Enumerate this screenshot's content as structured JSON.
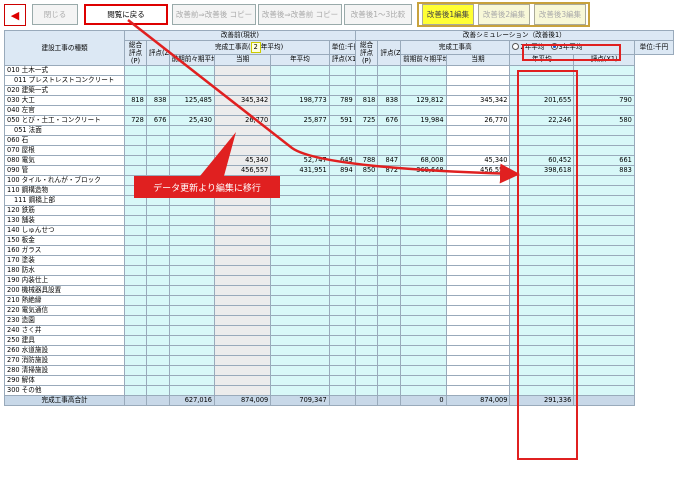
{
  "toolbar": {
    "back_icon": "left-arrow-icon",
    "close": "閉じる",
    "return_view": "閲覧に戻る",
    "copy_before": "改善前⇒改善後 コピー",
    "copy_after": "改善後⇒改善前 コピー",
    "compare": "改善後1〜3比較",
    "edit1": "改善後1編集",
    "edit2": "改善後2編集",
    "edit3": "改善後3編集"
  },
  "header": {
    "category": "建設工事の種類",
    "before_title": "改善前(現状)",
    "after_title": "改善シミュレーション（改善後1）",
    "total_score": "総合評点(P)",
    "score_z": "評点(Z)",
    "completed_before": "完成工事高(",
    "avg_num": "2",
    "completed_before_end": "年平均)",
    "completed_after": "完成工事高",
    "unit": "単位:千円",
    "prev_period": "前期前々期平均",
    "current": "当期",
    "annual_avg": "年平均",
    "score_x1": "評点(X1)",
    "radio2": "2年平均",
    "radio3": "3年平均"
  },
  "rows": [
    {
      "label": "010 土木一式"
    },
    {
      "label": "011 プレストレストコンクリート",
      "sub": true
    },
    {
      "label": "020 建築一式"
    },
    {
      "label": "030 大工",
      "b": [
        "818",
        "838",
        "125,485",
        "345,342",
        "198,773",
        "789"
      ],
      "a": [
        "818",
        "838",
        "129,812",
        "345,342",
        "201,655",
        "790"
      ]
    },
    {
      "label": "040 左官"
    },
    {
      "label": "050 とび・土工・コンクリート",
      "b": [
        "728",
        "676",
        "25,430",
        "26,770",
        "25,877",
        "591"
      ],
      "a": [
        "725",
        "676",
        "19,984",
        "26,770",
        "22,246",
        "580"
      ]
    },
    {
      "label": "051 法面",
      "sub": true
    },
    {
      "label": "060 石"
    },
    {
      "label": "070 屋根"
    },
    {
      "label": "080 電気",
      "b": [
        "",
        "",
        "",
        "45,340",
        "52,747",
        "649"
      ],
      "a": [
        "788",
        "847",
        "68,008",
        "45,340",
        "60,452",
        "661"
      ]
    },
    {
      "label": "090 管",
      "b": [
        "",
        "",
        "",
        "456,557",
        "431,951",
        "894"
      ],
      "a": [
        "850",
        "872",
        "369,648",
        "456,557",
        "398,618",
        "883"
      ]
    },
    {
      "label": "100 タイル・れんが・ブロック"
    },
    {
      "label": "110 鋼構造物"
    },
    {
      "label": "111 鋼橋上部",
      "sub": true
    },
    {
      "label": "120 鉄筋"
    },
    {
      "label": "130 舗装"
    },
    {
      "label": "140 しゅんせつ"
    },
    {
      "label": "150 板金"
    },
    {
      "label": "160 ガラス"
    },
    {
      "label": "170 塗装"
    },
    {
      "label": "180 防水"
    },
    {
      "label": "190 内装仕上"
    },
    {
      "label": "200 機械器具設置"
    },
    {
      "label": "210 熱絶縁"
    },
    {
      "label": "220 電気通信"
    },
    {
      "label": "230 造園"
    },
    {
      "label": "240 さく井"
    },
    {
      "label": "250 建具"
    },
    {
      "label": "260 水道施設"
    },
    {
      "label": "270 消防施設"
    },
    {
      "label": "280 清掃施設"
    },
    {
      "label": "290 解体"
    },
    {
      "label": "300 その他"
    }
  ],
  "total": {
    "label": "完成工事高合計",
    "b": [
      "627,016",
      "874,009",
      "709,347"
    ],
    "a": [
      "0",
      "874,009",
      "291,336"
    ]
  },
  "callout": "データ更新より編集に移行"
}
